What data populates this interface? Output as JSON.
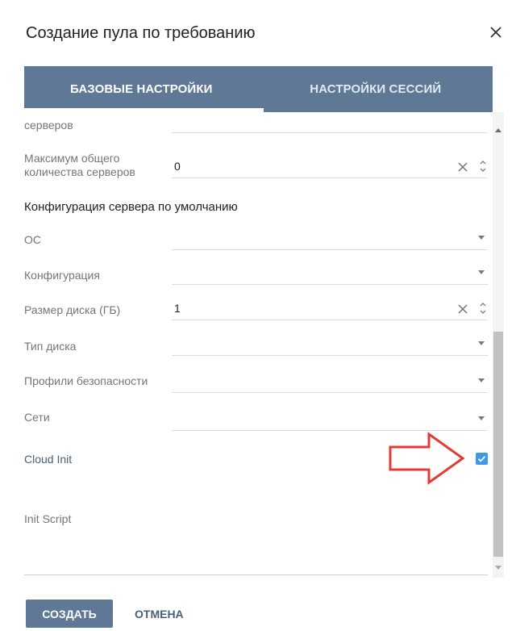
{
  "dialog": {
    "title": "Создание пула по требованию",
    "close_icon": "close-icon"
  },
  "tabs": [
    {
      "label": "БАЗОВЫЕ НАСТРОЙКИ",
      "active": true
    },
    {
      "label": "НАСТРОЙКИ СЕССИЙ",
      "active": false
    }
  ],
  "form": {
    "partial_label": "серверов",
    "max_servers": {
      "label_line1": "Максимум общего",
      "label_line2": "количества серверов",
      "value": "0"
    },
    "section_title": "Конфигурация сервера по умолчанию",
    "os": {
      "label": "ОС",
      "value": ""
    },
    "configuration": {
      "label": "Конфигурация",
      "value": ""
    },
    "disk_size": {
      "label": "Размер диска (ГБ)",
      "value": "1"
    },
    "disk_type": {
      "label": "Тип диска",
      "value": ""
    },
    "security_profiles": {
      "label": "Профили безопасности",
      "value": ""
    },
    "networks": {
      "label": "Сети",
      "value": ""
    },
    "cloud_init": {
      "label": "Cloud Init",
      "checked": true
    },
    "init_script": {
      "label": "Init Script",
      "value": ""
    }
  },
  "footer": {
    "create_label": "СОЗДАТЬ",
    "cancel_label": "ОТМЕНА"
  },
  "colors": {
    "accent": "#5e7896",
    "checkbox": "#3d9ae8",
    "annotation_arrow": "#e53935"
  }
}
